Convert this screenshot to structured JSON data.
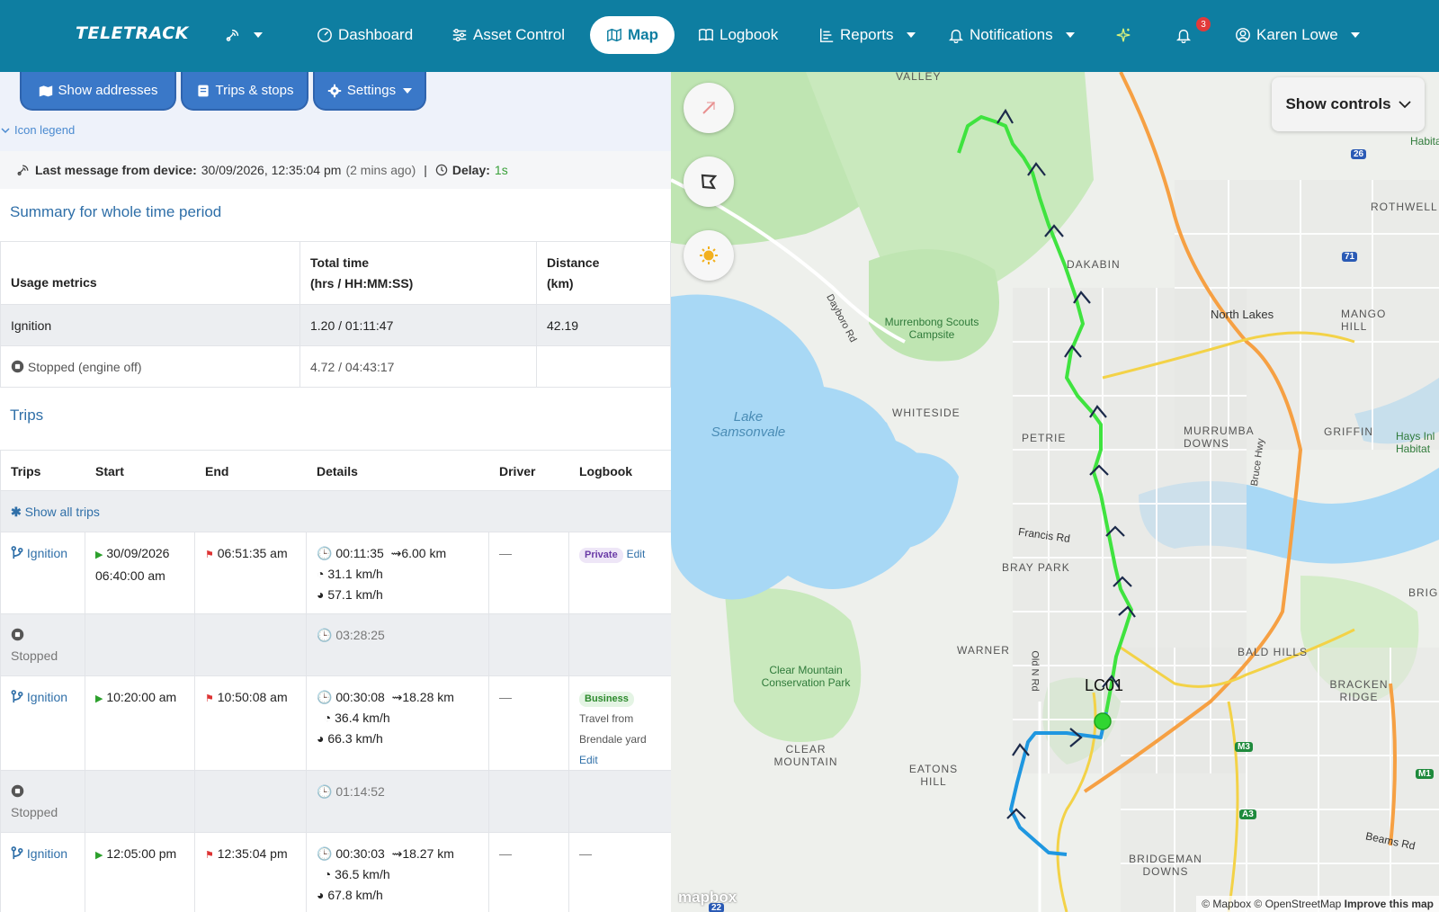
{
  "nav": {
    "brand": "TELETRACK",
    "items": [
      {
        "label": "Dashboard"
      },
      {
        "label": "Asset Control"
      },
      {
        "label": "Map"
      },
      {
        "label": "Logbook"
      },
      {
        "label": "Reports"
      },
      {
        "label": "Notifications"
      }
    ],
    "notification_count": "3",
    "user_name": "Karen Lowe"
  },
  "toolbar": {
    "show_addresses": "Show addresses",
    "trips_stops": "Trips & stops",
    "settings": "Settings",
    "icon_legend": "Icon legend"
  },
  "status": {
    "last_message_label": "Last message from device:",
    "last_message_value": "30/09/2026, 12:35:04 pm",
    "ago": "(2 mins ago)",
    "sep": "|",
    "delay_label": "Delay:",
    "delay_value": "1s"
  },
  "summary": {
    "title": "Summary for whole time period",
    "headers": {
      "metric": "Usage metrics",
      "total_line1": "Total time",
      "total_line2": "(hrs / HH:MM:SS)",
      "dist_line1": "Distance",
      "dist_line2": "(km)"
    },
    "rows": [
      {
        "metric": "Ignition",
        "total": "1.20 / 01:11:47",
        "distance": "42.19"
      },
      {
        "metric": "Stopped (engine off)",
        "total": "4.72 / 04:43:17",
        "distance": ""
      }
    ]
  },
  "trips": {
    "title": "Trips",
    "headers": [
      "Trips",
      "Start",
      "End",
      "Details",
      "Driver",
      "Logbook"
    ],
    "show_all": "Show all trips",
    "rows": [
      {
        "type": "Ignition",
        "start1": "30/09/2026",
        "start2": "06:40:00 am",
        "end": "06:51:35 am",
        "duration": "00:11:35",
        "distance": "6.00 km",
        "avg": "31.1 km/h",
        "max": "57.1 km/h",
        "driver": "—",
        "logbook_pill": "Private",
        "logbook_edit": "Edit"
      },
      {
        "type": "Stopped",
        "duration": "03:28:25"
      },
      {
        "type": "Ignition",
        "start1": "10:20:00 am",
        "end": "10:50:08 am",
        "duration": "00:30:08",
        "distance": "18.28 km",
        "avg": "36.4 km/h",
        "max": "66.3 km/h",
        "driver": "—",
        "logbook_pill": "Business",
        "logbook_note1": "Travel from",
        "logbook_note2": "Brendale yard",
        "logbook_edit": "Edit"
      },
      {
        "type": "Stopped",
        "duration": "01:14:52"
      },
      {
        "type": "Ignition",
        "start1": "12:05:00 pm",
        "end": "12:35:04 pm",
        "duration": "00:30:03",
        "distance": "18.27 km",
        "avg": "36.5 km/h",
        "max": "67.8 km/h",
        "driver": "—",
        "logbook": "—"
      }
    ]
  },
  "map": {
    "show_controls": "Show controls",
    "vehicle_label": "LC01",
    "labels": [
      "VALLEY",
      "DAKABIN",
      "ROTHWELL",
      "North Lakes",
      "MANGO HILL",
      "Murrenbong Scouts Campsite",
      "Dayboro Rd",
      "WHITESIDE",
      "PETRIE",
      "MURRUMBA DOWNS",
      "GRIFFIN",
      "Lake Samsonvale",
      "Bruce Hwy",
      "Francis Rd",
      "BRAY PARK",
      "BRIG",
      "WARNER",
      "Old N Rd",
      "BALD HILLS",
      "BRACKEN RIDGE",
      "Clear Mountain Conservation Park",
      "CLEAR MOUNTAIN",
      "EATONS HILL",
      "BRIDGEMAN DOWNS",
      "Beams Rd",
      "Hays Inl Habitat",
      "Habita"
    ],
    "shields": [
      "26",
      "71",
      "M3",
      "M1",
      "A3",
      "22"
    ],
    "attribution": "© Mapbox © OpenStreetMap",
    "improve": "Improve this map",
    "mapbox_logo": "mapbox",
    "colors": {
      "trip_green": "#3fe33f",
      "trip_blue": "#1f97e0",
      "water": "#a8d8f5",
      "park": "#bfe5b2"
    }
  }
}
